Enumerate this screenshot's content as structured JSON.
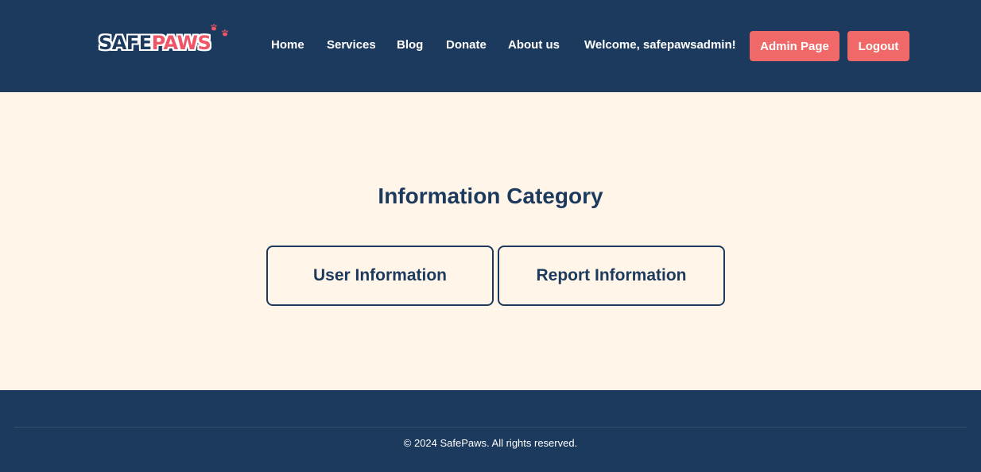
{
  "header": {
    "logo": {
      "word1": "SAFE",
      "word2": "PAWS"
    },
    "nav": [
      {
        "label": "Home"
      },
      {
        "label": "Services"
      },
      {
        "label": "Blog"
      },
      {
        "label": "Donate"
      },
      {
        "label": "About us"
      }
    ],
    "welcome": "Welcome, safepawsadmin!",
    "admin_button": "Admin Page",
    "logout_button": "Logout"
  },
  "main": {
    "title": "Information Category",
    "buttons": [
      {
        "label": "User Information"
      },
      {
        "label": "Report Information"
      }
    ]
  },
  "footer": {
    "copyright": "© 2024 SafePaws. All rights reserved."
  },
  "colors": {
    "navy": "#1c3a5e",
    "cream": "#fff5e8",
    "coral": "#f06868"
  }
}
